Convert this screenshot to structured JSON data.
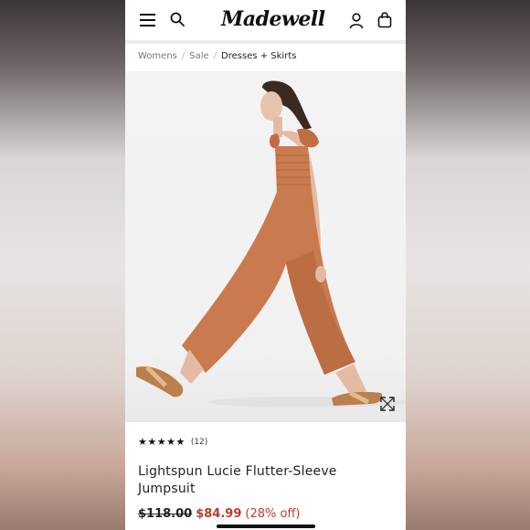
{
  "header": {
    "logo_text": "Madewell",
    "icons": [
      "hamburger-menu-icon",
      "search-icon",
      "account-icon",
      "shopping-bag-icon"
    ]
  },
  "breadcrumb": {
    "items": [
      "Womens",
      "Sale",
      "Dresses + Skirts"
    ]
  },
  "gallery": {
    "image_count": 5,
    "active_index": 1,
    "icons": [
      "expand-icon"
    ]
  },
  "product": {
    "rating_stars": "★★★★★",
    "rating_value": 5,
    "review_count": "(12)",
    "title": "Lightspun Lucie Flutter-Sleeve Jumpsuit",
    "original_price": "$118.00",
    "sale_price": "$84.99",
    "discount": "(28% off)"
  },
  "colors": {
    "sale_red": "#c0392b",
    "jumpsuit": "#c97a4e",
    "text": "#222222"
  }
}
